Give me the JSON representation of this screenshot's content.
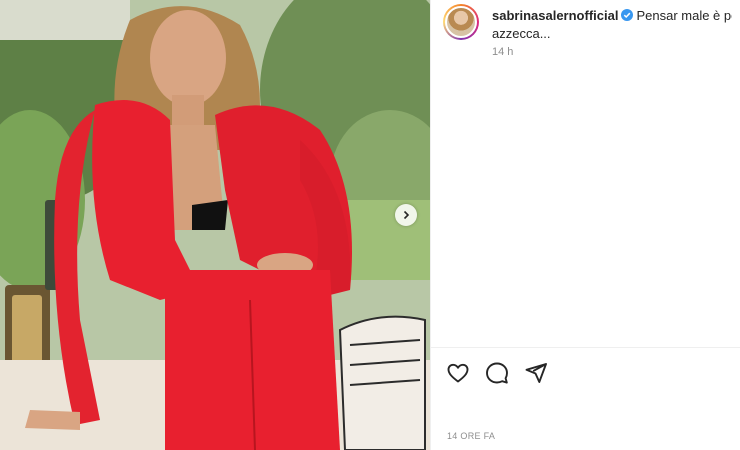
{
  "post": {
    "username": "sabrinasalernofficial",
    "verified": true,
    "caption_line1": "Pensar male è pec",
    "caption_line2": "azzecca...",
    "time_short": "14 h",
    "time_long": "14 ORE FA"
  },
  "icons": {
    "verified": "verified-badge-icon",
    "like": "heart-icon",
    "comment": "comment-icon",
    "share": "paper-plane-icon",
    "next": "chevron-right-icon"
  },
  "colors": {
    "verified": "#3897f0",
    "dress": "#e8202f",
    "meta_text": "#8e8e8e"
  }
}
